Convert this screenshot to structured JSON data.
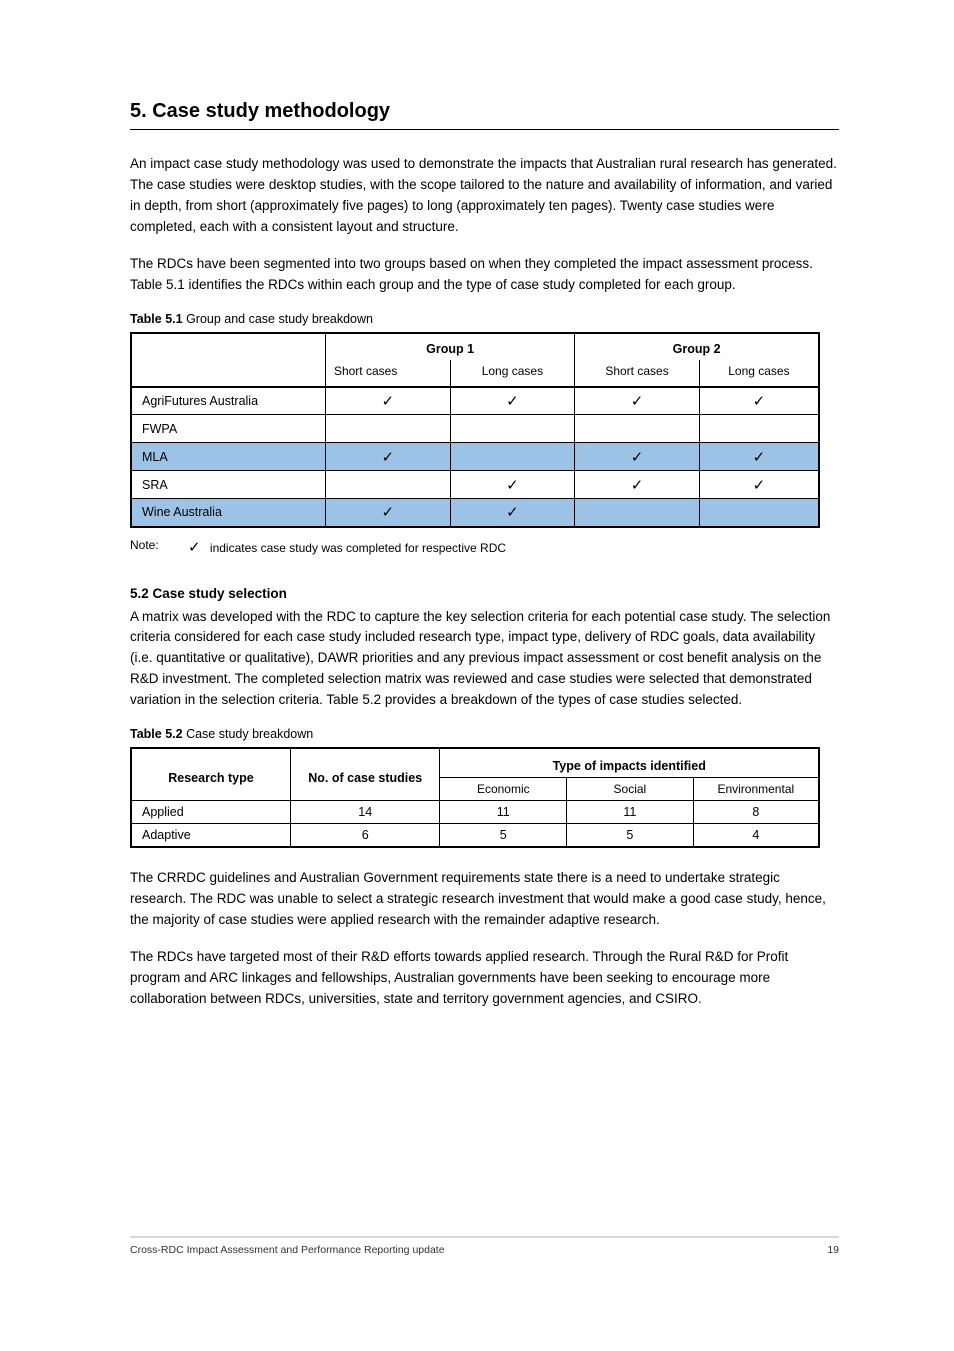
{
  "section": {
    "title": "5. Case study methodology"
  },
  "intro": {
    "p1": "An impact case study methodology was used to demonstrate the impacts that Australian rural research has generated. The case studies were desktop studies, with the scope tailored to the nature and availability of information, and varied in depth, from short (approximately five pages) to long (approximately ten pages). Twenty case studies were completed, each with a consistent layout and structure.",
    "p2": "The RDCs have been segmented into two groups based on when they completed the impact assessment process. Table 5.1 identifies the RDCs within each group and the type of case study completed for each group."
  },
  "table1": {
    "label": "Table 5.1",
    "caption": "Group and case study breakdown",
    "head": {
      "col0": "",
      "g1": "Group 1",
      "g2": "Group 2",
      "sub0": "",
      "sub1": "Short cases",
      "sub2": "Long cases",
      "sub3": "Short cases",
      "sub4": "Long cases"
    },
    "rows": [
      {
        "label": "AgriFutures Australia",
        "cells": [
          "✓",
          "✓",
          "✓",
          "✓"
        ],
        "blue": false
      },
      {
        "label": "FWPA",
        "cells": [
          "",
          "",
          "",
          ""
        ],
        "blue": false
      },
      {
        "label": "MLA",
        "cells": [
          "✓",
          "",
          "✓",
          "✓"
        ],
        "blue": true
      },
      {
        "label": "SRA",
        "cells": [
          "",
          "✓",
          "✓",
          "✓"
        ],
        "blue": false
      },
      {
        "label": "Wine Australia",
        "cells": [
          "✓",
          "✓",
          "",
          ""
        ],
        "blue": true
      }
    ],
    "note_label": "Note:",
    "note_text": "indicates case study was completed for respective RDC"
  },
  "section52": {
    "heading": "5.2 Case study selection",
    "para": "A matrix was developed with the RDC to capture the key selection criteria for each potential case study. The selection criteria considered for each case study included research type, impact type, delivery of RDC goals, data availability (i.e. quantitative or qualitative), DAWR priorities and any previous impact assessment or cost benefit analysis on the R&D investment. The completed selection matrix was reviewed and case studies were selected that demonstrated variation in the selection criteria. Table 5.2 provides a breakdown of the types of case studies selected."
  },
  "table2": {
    "label": "Table 5.2",
    "caption": "Case study breakdown",
    "head": {
      "col0": "Research type",
      "col1": "No. of case studies",
      "impact_group": "Type of impacts identified",
      "sub_econ": "Economic",
      "sub_social": "Social",
      "sub_env": "Environmental"
    },
    "rows": [
      {
        "label": "Applied",
        "count": "14",
        "econ": "11",
        "social": "11",
        "env": "8"
      },
      {
        "label": "Adaptive",
        "count": "6",
        "econ": "5",
        "social": "5",
        "env": "4"
      }
    ]
  },
  "outro": {
    "p1": "The CRRDC guidelines and Australian Government requirements state there is a need to undertake strategic research. The RDC was unable to select a strategic research investment that would make a good case study, hence, the majority of case studies were applied research with the remainder adaptive research.",
    "p2": "The RDCs have targeted most of their R&D efforts towards applied research. Through the Rural R&D for Profit program and ARC linkages and fellowships, Australian governments have been seeking to encourage more collaboration between RDCs, universities, state and territory government agencies, and CSIRO."
  },
  "footer": {
    "left": "Cross-RDC Impact Assessment and Performance Reporting update",
    "right": "19"
  }
}
